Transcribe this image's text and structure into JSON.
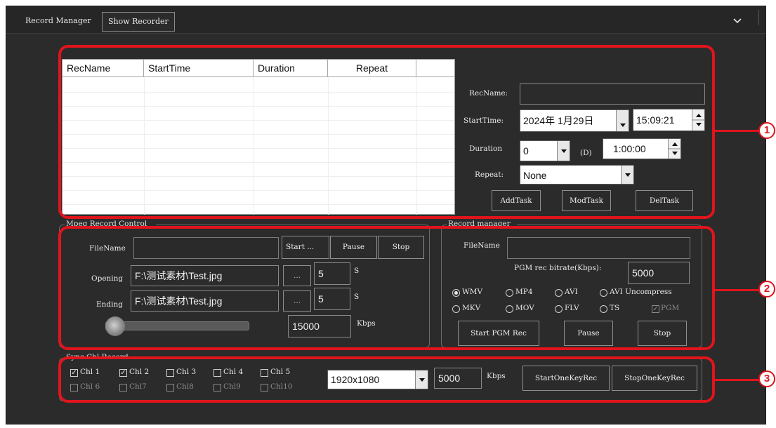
{
  "header": {
    "tab_record_manager": "Record Manager",
    "tab_show_recorder": "Show Recorder",
    "collapse_icon": "chevron-down-icon"
  },
  "task_table": {
    "columns": [
      "RecName",
      "StartTime",
      "Duration",
      "Repeat"
    ],
    "rows": []
  },
  "task_form": {
    "recname_label": "RecName:",
    "recname_value": "",
    "starttime_label": "StartTime:",
    "start_date": "2024年 1月29日",
    "start_time": "15:09:21",
    "duration_label": "Duration",
    "duration_days": "0",
    "days_unit": "(D)",
    "duration_time": "1:00:00",
    "repeat_label": "Repeat:",
    "repeat_value": "None",
    "add_task": "AddTask",
    "mod_task": "ModTask",
    "del_task": "DelTask"
  },
  "mpeg_control": {
    "title": "Mpeg Record Control",
    "filename_label": "FileName",
    "filename_value": "",
    "start": "Start ...",
    "pause": "Pause",
    "stop": "Stop",
    "opening_label": "Opening",
    "opening_file": "F:\\测试素材\\Test.jpg",
    "opening_browse": "...",
    "opening_seconds": "5",
    "opening_unit": "S",
    "ending_label": "Ending",
    "ending_file": "F:\\测试素材\\Test.jpg",
    "ending_browse": "...",
    "ending_seconds": "5",
    "ending_unit": "S",
    "bitrate": "15000",
    "bitrate_unit": "Kbps"
  },
  "pgm_manager": {
    "title": "Record manager",
    "filename_label": "FileName",
    "filename_value": "",
    "bitrate_label": "PGM rec bitrate(Kbps):",
    "bitrate_value": "5000",
    "formats_row1": [
      {
        "label": "WMV",
        "selected": true
      },
      {
        "label": "MP4",
        "selected": false
      },
      {
        "label": "AVI",
        "selected": false
      },
      {
        "label": "AVI Uncompress",
        "selected": false
      }
    ],
    "formats_row2": [
      {
        "label": "MKV",
        "selected": false
      },
      {
        "label": "MOV",
        "selected": false
      },
      {
        "label": "FLV",
        "selected": false
      },
      {
        "label": "TS",
        "selected": false
      }
    ],
    "pgm_check_label": "PGM",
    "pgm_checked": true,
    "start": "Start PGM Rec",
    "pause": "Pause",
    "stop": "Stop"
  },
  "sync_record": {
    "title": "Sync Chl Record",
    "channels_row1": [
      {
        "label": "Chl 1",
        "checked": true
      },
      {
        "label": "Chl 2",
        "checked": true
      },
      {
        "label": "Chl 3",
        "checked": false
      },
      {
        "label": "Chl 4",
        "checked": false
      },
      {
        "label": "Chl 5",
        "checked": false
      }
    ],
    "channels_row2": [
      {
        "label": "Chl 6",
        "checked": false
      },
      {
        "label": "Chl7",
        "checked": false
      },
      {
        "label": "Chl8",
        "checked": false
      },
      {
        "label": "Chl9",
        "checked": false
      },
      {
        "label": "Chl10",
        "checked": false
      }
    ],
    "resolution": "1920x1080",
    "bitrate": "5000",
    "bitrate_unit": "Kbps",
    "start": "StartOneKeyRec",
    "stop": "StopOneKeyRec"
  },
  "callouts": [
    "1",
    "2",
    "3"
  ],
  "colors": {
    "highlight": "#e0141c",
    "panel": "#2b2b2b"
  }
}
